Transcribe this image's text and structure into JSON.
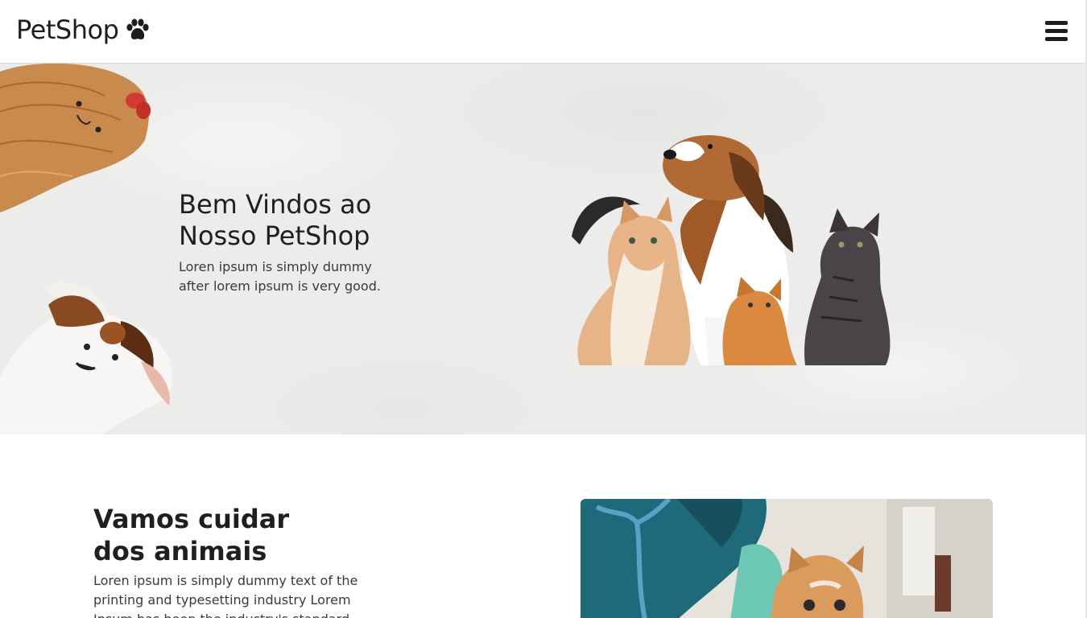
{
  "header": {
    "brand": "PetShop",
    "paw_icon": "paw-icon",
    "menu_icon": "hamburger-menu-icon"
  },
  "hero": {
    "title_line1": "Bem Vindos ao",
    "title_line2": "Nosso PetShop",
    "subtitle_line1": "Loren ipsum is simply dummy",
    "subtitle_line2": "after lorem ipsum is very good.",
    "background_color": "#ececeb"
  },
  "about": {
    "title_line1": "Vamos cuidar",
    "title_line2": "dos animais",
    "text_line1": "Loren ipsum is simply dummy text of the",
    "text_line2": "printing and typesetting industry Lorem",
    "text_line3": "Ipsum has been the industry's standard"
  },
  "colors": {
    "text": "#1f1f1f",
    "scrub_teal": "#1f6a7a",
    "glove": "#6cc8b4"
  }
}
